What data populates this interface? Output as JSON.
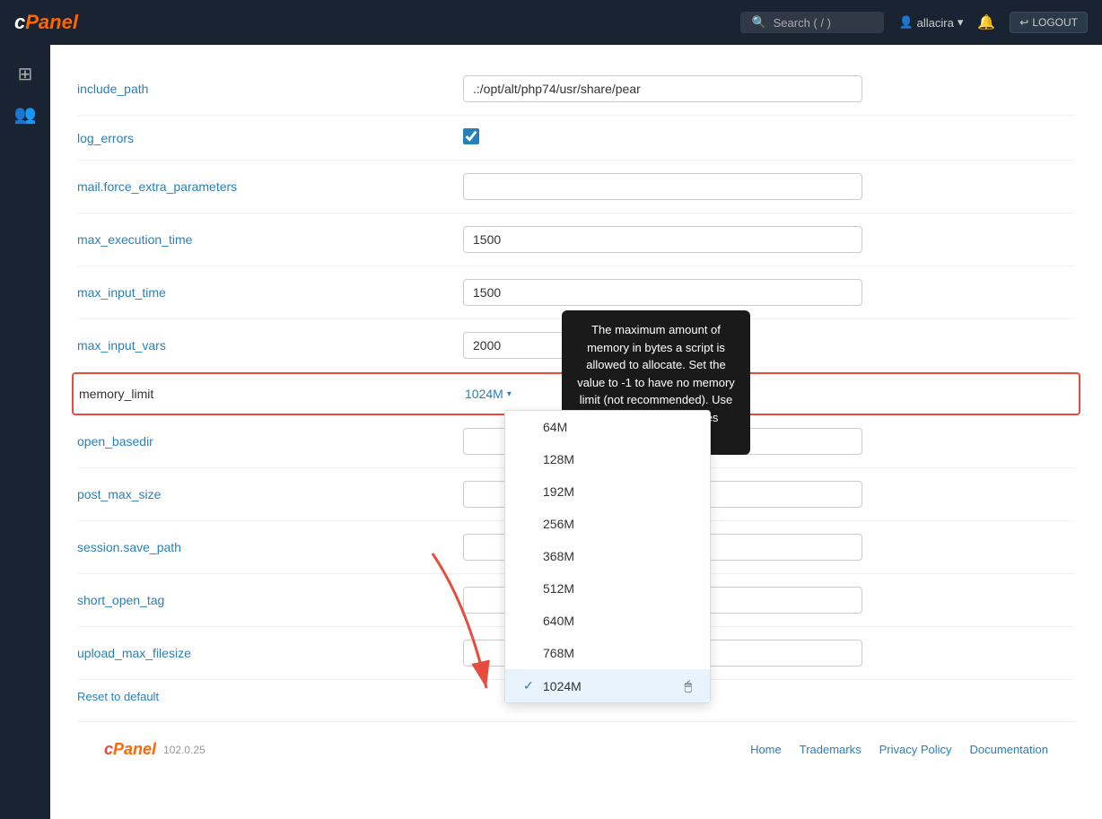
{
  "navbar": {
    "brand": "cPanel",
    "brand_c": "c",
    "brand_panel": "Panel",
    "search_placeholder": "Search ( / )",
    "user": "allacira",
    "logout_label": "LOGOUT"
  },
  "sidebar": {
    "icons": [
      "grid-icon",
      "users-icon"
    ]
  },
  "settings": [
    {
      "id": "include_path",
      "label": "include_path",
      "type": "text",
      "value": ".:/opt/alt/php74/usr/share/pear"
    },
    {
      "id": "log_errors",
      "label": "log_errors",
      "type": "checkbox",
      "checked": true
    },
    {
      "id": "mail_force_extra_parameters",
      "label": "mail.force_extra_parameters",
      "type": "text",
      "value": ""
    },
    {
      "id": "max_execution_time",
      "label": "max_execution_time",
      "type": "text",
      "value": "1500"
    },
    {
      "id": "max_input_time",
      "label": "max_input_time",
      "type": "text",
      "value": "1500"
    },
    {
      "id": "max_input_vars",
      "label": "max_input_vars",
      "type": "text",
      "value": "2000"
    },
    {
      "id": "memory_limit",
      "label": "memory_limit",
      "type": "dropdown",
      "value": "1024M",
      "highlighted": true
    },
    {
      "id": "open_basedir",
      "label": "open_basedir",
      "type": "text",
      "value": ""
    },
    {
      "id": "post_max_size",
      "label": "post_max_size",
      "type": "text",
      "value": ""
    },
    {
      "id": "session_save_path",
      "label": "session.save_path",
      "type": "text",
      "value": ""
    },
    {
      "id": "short_open_tag",
      "label": "short_open_tag",
      "type": "text",
      "value": ""
    },
    {
      "id": "upload_max_filesize",
      "label": "upload_max_filesize",
      "type": "text",
      "value": ""
    }
  ],
  "tooltip": {
    "text": "The maximum amount of memory in bytes a script is allowed to allocate. Set the value to -1 to have no memory limit (not recommended). Use shortcuts for megabytes (mega), 128M"
  },
  "dropdown_options": [
    "64M",
    "128M",
    "192M",
    "256M",
    "368M",
    "512M",
    "640M",
    "768M",
    "1024M"
  ],
  "dropdown_selected": "1024M",
  "reset_label": "Reset to default",
  "footer": {
    "version": "102.0.25",
    "links": [
      "Home",
      "Trademarks",
      "Privacy Policy",
      "Documentation"
    ]
  }
}
